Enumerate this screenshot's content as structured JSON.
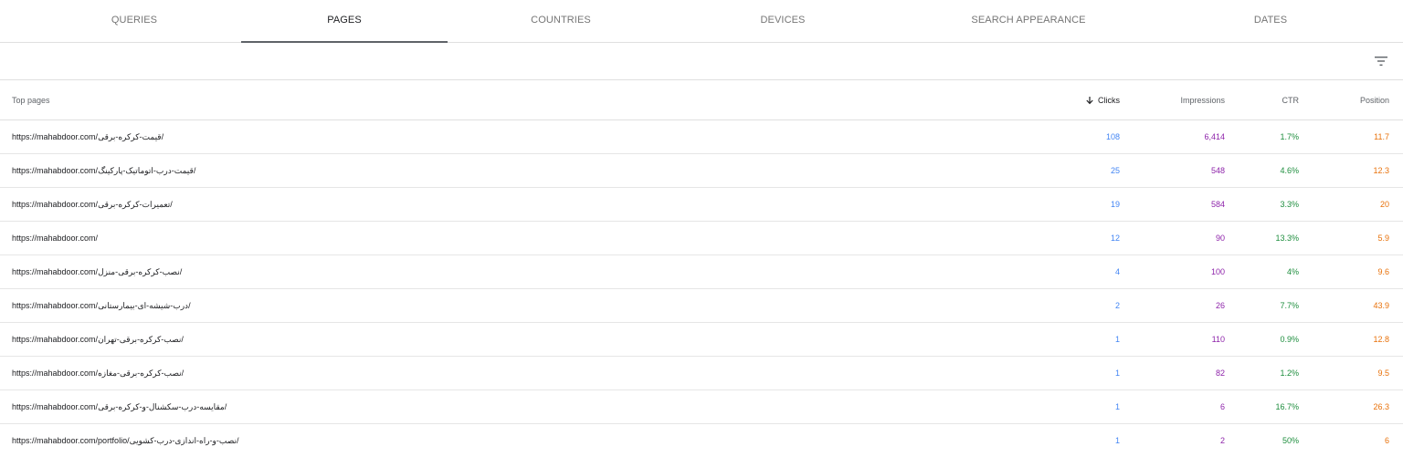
{
  "tabs": [
    {
      "label": "QUERIES",
      "active": false
    },
    {
      "label": "PAGES",
      "active": true
    },
    {
      "label": "COUNTRIES",
      "active": false
    },
    {
      "label": "DEVICES",
      "active": false
    },
    {
      "label": "SEARCH APPEARANCE",
      "active": false
    },
    {
      "label": "DATES",
      "active": false
    }
  ],
  "toolbar": {
    "filter_icon": "filter-list-icon"
  },
  "table": {
    "headers": {
      "page": "Top pages",
      "clicks": "Clicks",
      "impressions": "Impressions",
      "ctr": "CTR",
      "position": "Position"
    },
    "sort": {
      "column": "clicks",
      "direction": "descending",
      "icon": "arrow-down-icon"
    },
    "rows": [
      {
        "page": "https://mahabdoor.com/قیمت-کرکره-برقی/",
        "clicks": "108",
        "impressions": "6,414",
        "ctr": "1.7%",
        "position": "11.7"
      },
      {
        "page": "https://mahabdoor.com/قیمت-درب-اتوماتیک-پارکینگ/",
        "clicks": "25",
        "impressions": "548",
        "ctr": "4.6%",
        "position": "12.3"
      },
      {
        "page": "https://mahabdoor.com/تعمیرات-کرکره-برقی/",
        "clicks": "19",
        "impressions": "584",
        "ctr": "3.3%",
        "position": "20"
      },
      {
        "page": "https://mahabdoor.com/",
        "clicks": "12",
        "impressions": "90",
        "ctr": "13.3%",
        "position": "5.9"
      },
      {
        "page": "https://mahabdoor.com/نصب-کرکره-برقی-منزل/",
        "clicks": "4",
        "impressions": "100",
        "ctr": "4%",
        "position": "9.6"
      },
      {
        "page": "https://mahabdoor.com/درب-شیشه-ای-بیمارستانی/",
        "clicks": "2",
        "impressions": "26",
        "ctr": "7.7%",
        "position": "43.9"
      },
      {
        "page": "https://mahabdoor.com/نصب-کرکره-برقی-تهران/",
        "clicks": "1",
        "impressions": "110",
        "ctr": "0.9%",
        "position": "12.8"
      },
      {
        "page": "https://mahabdoor.com/نصب-کرکره-برقی-مغازه/",
        "clicks": "1",
        "impressions": "82",
        "ctr": "1.2%",
        "position": "9.5"
      },
      {
        "page": "https://mahabdoor.com/مقایسه-درب-سکشنال-و-کرکره-برقی/",
        "clicks": "1",
        "impressions": "6",
        "ctr": "16.7%",
        "position": "26.3"
      },
      {
        "page": "https://mahabdoor.com/portfolio/نصب-و-راه-اندازی-درب-کشویی/",
        "clicks": "1",
        "impressions": "2",
        "ctr": "50%",
        "position": "6"
      }
    ]
  },
  "colors": {
    "clicks": "#4285f4",
    "impressions": "#8e24aa",
    "ctr": "#1e8e3e",
    "position": "#e8710a"
  }
}
